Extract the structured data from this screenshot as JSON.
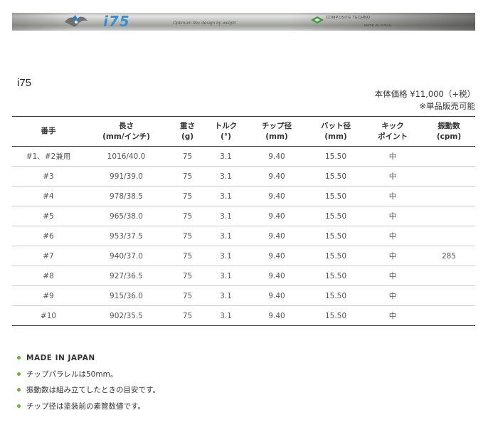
{
  "banner": {
    "model_mark": "i75",
    "tagline": "Optimum flex design by weight",
    "maker_name": "COMPOSITE TECHNO",
    "made_in": "MADE IN JAPAN",
    "colors": {
      "model_blue": "#3a8fd0",
      "maker_green": "#3a9a3e"
    }
  },
  "product": {
    "title": "i75",
    "price": "本体価格 ¥11,000（+税）",
    "sale_note": "※単品販売可能"
  },
  "table": {
    "headers": [
      {
        "line1": "番手",
        "line2": ""
      },
      {
        "line1": "長さ",
        "line2": "(mm/インチ)"
      },
      {
        "line1": "重さ",
        "line2": "(g)"
      },
      {
        "line1": "トルク",
        "line2": "(°)"
      },
      {
        "line1": "チップ径",
        "line2": "(mm)"
      },
      {
        "line1": "バット径",
        "line2": "(mm)"
      },
      {
        "line1": "キック",
        "line2": "ポイント"
      },
      {
        "line1": "振動数",
        "line2": "(cpm)"
      }
    ],
    "rows": [
      [
        "#1、#2兼用",
        "1016/40.0",
        "75",
        "3.1",
        "9.40",
        "15.50",
        "中",
        ""
      ],
      [
        "#3",
        "991/39.0",
        "75",
        "3.1",
        "9.40",
        "15.50",
        "中",
        ""
      ],
      [
        "#4",
        "978/38.5",
        "75",
        "3.1",
        "9.40",
        "15.50",
        "中",
        ""
      ],
      [
        "#5",
        "965/38.0",
        "75",
        "3.1",
        "9.40",
        "15.50",
        "中",
        ""
      ],
      [
        "#6",
        "953/37.5",
        "75",
        "3.1",
        "9.40",
        "15.50",
        "中",
        ""
      ],
      [
        "#7",
        "940/37.0",
        "75",
        "3.1",
        "9.40",
        "15.50",
        "中",
        "285"
      ],
      [
        "#8",
        "927/36.5",
        "75",
        "3.1",
        "9.40",
        "15.50",
        "中",
        ""
      ],
      [
        "#9",
        "915/36.0",
        "75",
        "3.1",
        "9.40",
        "15.50",
        "中",
        ""
      ],
      [
        "#10",
        "902/35.5",
        "75",
        "3.1",
        "9.40",
        "15.50",
        "中",
        ""
      ]
    ]
  },
  "notes": {
    "bullet_color": "#67b53a",
    "items": [
      "MADE IN JAPAN",
      "チップパラレルは50mm。",
      "振動数は組み立てしたときの目安です。",
      "チップ径は塗装前の素管数値です。"
    ]
  }
}
